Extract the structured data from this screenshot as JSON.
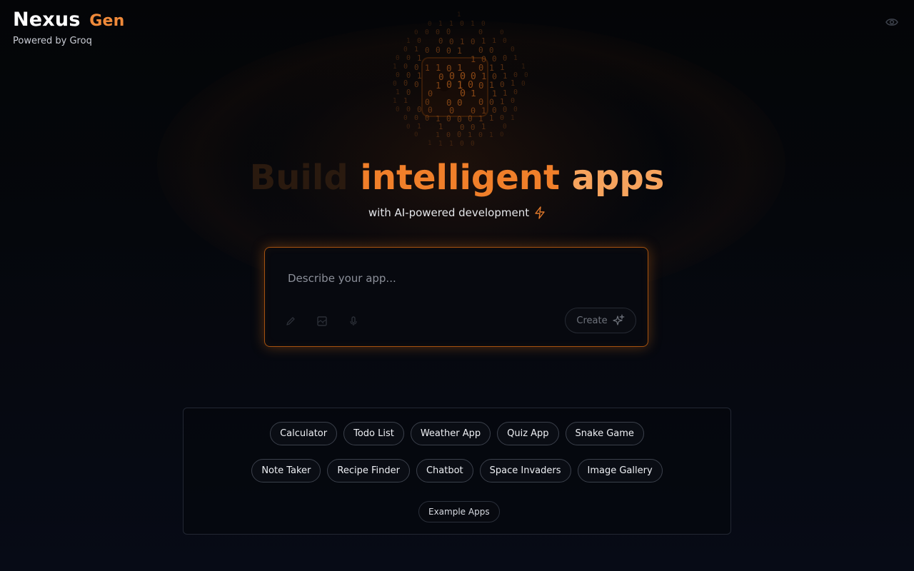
{
  "brand": {
    "name": "Nexus",
    "suffix": "Gen",
    "tagline": "Powered by Groq"
  },
  "header": {
    "toggle_icon": "eye-icon"
  },
  "hero": {
    "title_word_1": "Build",
    "title_word_2": "intelligent",
    "title_word_3": "apps",
    "subtitle": "with AI-powered development",
    "subtitle_icon": "lightning-icon"
  },
  "prompt": {
    "placeholder": "Describe your app...",
    "value": "",
    "tools": [
      "pencil-icon",
      "image-icon",
      "microphone-icon"
    ],
    "create_label": "Create",
    "create_icon": "sparkle-icon"
  },
  "suggestions": {
    "row1": [
      "Calculator",
      "Todo List",
      "Weather App",
      "Quiz App",
      "Snake Game"
    ],
    "row2": [
      "Note Taker",
      "Recipe Finder",
      "Chatbot",
      "Space Invaders",
      "Image Gallery"
    ],
    "examples_label": "Example Apps"
  },
  "colors": {
    "accent": "#f07f2a",
    "accent_light": "#f6a35d",
    "background": "#05070d",
    "card_border": "#a5520f"
  }
}
